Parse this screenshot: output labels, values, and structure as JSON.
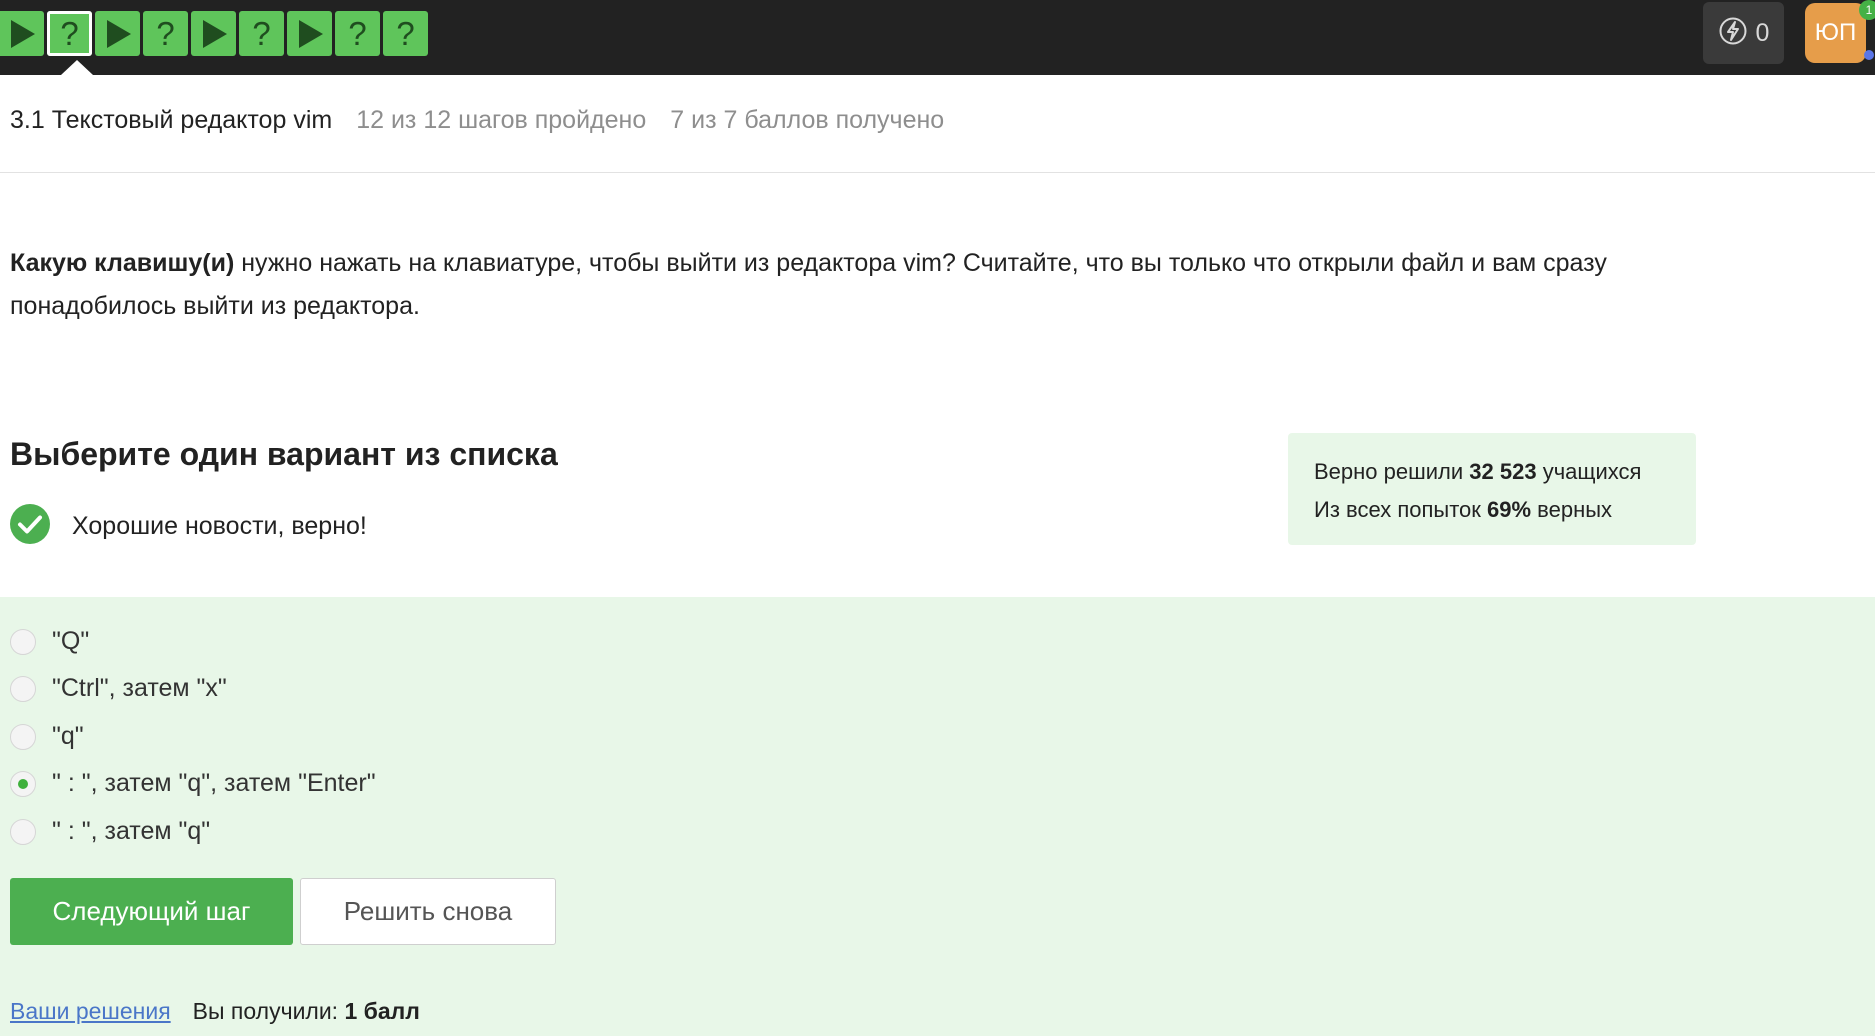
{
  "colors": {
    "topbar": "#222222",
    "step_green": "#5fc55b",
    "accent_green": "#4caf50",
    "success_bg": "#e8f7e8",
    "avatar_bg": "#e69d4a",
    "link": "#4a76c8"
  },
  "steps": [
    {
      "type": "play",
      "icon": "play-icon"
    },
    {
      "type": "question",
      "label": "?",
      "current": true
    },
    {
      "type": "play",
      "icon": "play-icon"
    },
    {
      "type": "question",
      "label": "?"
    },
    {
      "type": "play",
      "icon": "play-icon"
    },
    {
      "type": "question",
      "label": "?"
    },
    {
      "type": "play",
      "icon": "play-icon"
    },
    {
      "type": "question",
      "label": "?"
    },
    {
      "type": "question",
      "label": "?"
    }
  ],
  "header": {
    "energy_icon": "lightning-icon",
    "energy_count": "0",
    "avatar_initials": "ЮП",
    "notifications_count": "1"
  },
  "lesson": {
    "title": "3.1 Текстовый редактор vim",
    "steps_progress": "12 из 12 шагов пройдено",
    "score_progress": "7 из 7 баллов  получено"
  },
  "question": {
    "bold_part": "Какую клавишу(и)",
    "text": " нужно нажать на клавиатуре, чтобы выйти из редактора vim? Считайте, что вы только что открыли файл и вам сразу понадобилось выйти из редактора."
  },
  "quiz": {
    "title": "Выберите один вариант из списка",
    "feedback": "Хорошие новости, верно!",
    "options": [
      {
        "label": "\"Q\"",
        "checked": false
      },
      {
        "label": "\"Ctrl\", затем \"x\"",
        "checked": false
      },
      {
        "label": "\"q\"",
        "checked": false
      },
      {
        "label": "\" : \", затем \"q\", затем \"Enter\"",
        "checked": true
      },
      {
        "label": "\" : \", затем \"q\"",
        "checked": false
      }
    ],
    "next_button": "Следующий шаг",
    "retry_button": "Решить снова"
  },
  "stats": {
    "solved_prefix": "Верно решили ",
    "solved_count": "32 523",
    "solved_suffix": " учащихся",
    "attempts_prefix": "Из всех попыток ",
    "attempts_percent": "69%",
    "attempts_suffix": " верных"
  },
  "footer": {
    "solutions_link": "Ваши решения",
    "got_prefix": "Вы получили: ",
    "got_value": "1 балл"
  }
}
